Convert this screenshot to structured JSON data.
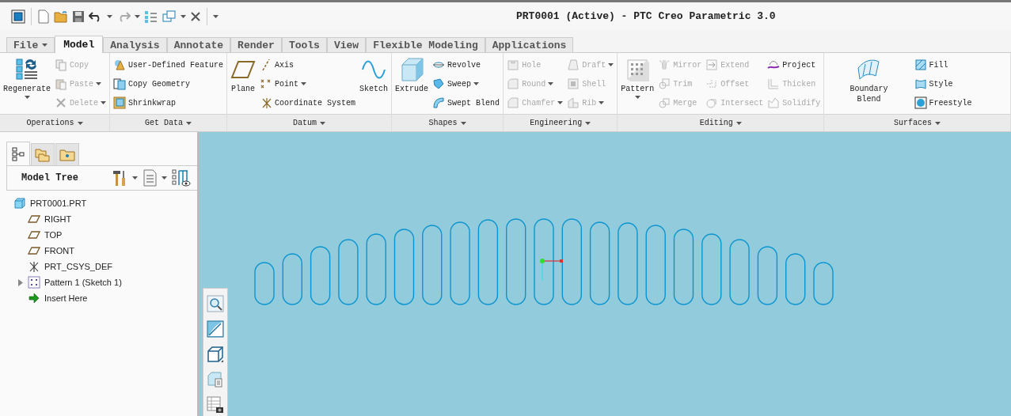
{
  "window": {
    "title": "PRT0001 (Active) - PTC Creo Parametric 3.0"
  },
  "tabs": [
    {
      "label": "File",
      "kind": "menu",
      "selected": false
    },
    {
      "label": "Model",
      "kind": "tab",
      "selected": true
    },
    {
      "label": "Analysis",
      "kind": "tab",
      "selected": false
    },
    {
      "label": "Annotate",
      "kind": "tab",
      "selected": false
    },
    {
      "label": "Render",
      "kind": "tab",
      "selected": false
    },
    {
      "label": "Tools",
      "kind": "tab",
      "selected": false
    },
    {
      "label": "View",
      "kind": "tab",
      "selected": false
    },
    {
      "label": "Flexible Modeling",
      "kind": "tab",
      "selected": false
    },
    {
      "label": "Applications",
      "kind": "tab",
      "selected": false
    }
  ],
  "ribbon": {
    "groups": [
      {
        "label": "Operations",
        "items": [
          {
            "label": "Regenerate",
            "kind": "large",
            "dropdown": true,
            "disabled": false
          },
          {
            "label": "Copy",
            "kind": "small",
            "dropdown": false,
            "disabled": true
          },
          {
            "label": "Paste",
            "kind": "small",
            "dropdown": true,
            "disabled": true
          },
          {
            "label": "Delete",
            "kind": "small",
            "dropdown": true,
            "disabled": true
          }
        ]
      },
      {
        "label": "Get Data",
        "items": [
          {
            "label": "User-Defined Feature",
            "kind": "small",
            "dropdown": false,
            "disabled": false
          },
          {
            "label": "Copy Geometry",
            "kind": "small",
            "dropdown": false,
            "disabled": false
          },
          {
            "label": "Shrinkwrap",
            "kind": "small",
            "dropdown": false,
            "disabled": false
          }
        ]
      },
      {
        "label": "Datum",
        "items": [
          {
            "label": "Plane",
            "kind": "large",
            "dropdown": false,
            "disabled": false
          },
          {
            "label": "Axis",
            "kind": "small",
            "dropdown": false,
            "disabled": false
          },
          {
            "label": "Point",
            "kind": "small",
            "dropdown": true,
            "disabled": false
          },
          {
            "label": "Coordinate System",
            "kind": "small",
            "dropdown": false,
            "disabled": false
          },
          {
            "label": "Sketch",
            "kind": "large",
            "dropdown": false,
            "disabled": false
          }
        ]
      },
      {
        "label": "Shapes",
        "items": [
          {
            "label": "Extrude",
            "kind": "large",
            "dropdown": false,
            "disabled": false
          },
          {
            "label": "Revolve",
            "kind": "small",
            "dropdown": false,
            "disabled": false
          },
          {
            "label": "Sweep",
            "kind": "small",
            "dropdown": true,
            "disabled": false
          },
          {
            "label": "Swept Blend",
            "kind": "small",
            "dropdown": false,
            "disabled": false
          }
        ]
      },
      {
        "label": "Engineering",
        "items": [
          {
            "label": "Hole",
            "kind": "small",
            "dropdown": false,
            "disabled": true
          },
          {
            "label": "Round",
            "kind": "small",
            "dropdown": true,
            "disabled": true
          },
          {
            "label": "Chamfer",
            "kind": "small",
            "dropdown": true,
            "disabled": true
          },
          {
            "label": "Draft",
            "kind": "small",
            "dropdown": true,
            "disabled": true
          },
          {
            "label": "Shell",
            "kind": "small",
            "dropdown": false,
            "disabled": true
          },
          {
            "label": "Rib",
            "kind": "small",
            "dropdown": true,
            "disabled": true
          }
        ]
      },
      {
        "label": "Editing",
        "items": [
          {
            "label": "Pattern",
            "kind": "large",
            "dropdown": true,
            "disabled": false
          },
          {
            "label": "Mirror",
            "kind": "small",
            "dropdown": false,
            "disabled": true
          },
          {
            "label": "Trim",
            "kind": "small",
            "dropdown": false,
            "disabled": true
          },
          {
            "label": "Merge",
            "kind": "small",
            "dropdown": false,
            "disabled": true
          },
          {
            "label": "Extend",
            "kind": "small",
            "dropdown": false,
            "disabled": true
          },
          {
            "label": "Offset",
            "kind": "small",
            "dropdown": false,
            "disabled": true
          },
          {
            "label": "Intersect",
            "kind": "small",
            "dropdown": false,
            "disabled": true
          },
          {
            "label": "Project",
            "kind": "small",
            "dropdown": false,
            "disabled": false
          },
          {
            "label": "Thicken",
            "kind": "small",
            "dropdown": false,
            "disabled": true
          },
          {
            "label": "Solidify",
            "kind": "small",
            "dropdown": false,
            "disabled": true
          }
        ]
      },
      {
        "label": "Surfaces",
        "items": [
          {
            "label": "Boundary Blend",
            "kind": "large",
            "dropdown": false,
            "disabled": false
          },
          {
            "label": "Fill",
            "kind": "small",
            "dropdown": false,
            "disabled": false
          },
          {
            "label": "Style",
            "kind": "small",
            "dropdown": false,
            "disabled": false
          },
          {
            "label": "Freestyle",
            "kind": "small",
            "dropdown": false,
            "disabled": false
          }
        ]
      }
    ]
  },
  "navigator": {
    "tabs": [
      {
        "selected": true
      },
      {
        "selected": false
      },
      {
        "selected": false
      }
    ],
    "title": "Model Tree",
    "tree": [
      {
        "label": "PRT0001.PRT",
        "kind": "part",
        "children": [
          {
            "label": "RIGHT",
            "kind": "plane"
          },
          {
            "label": "TOP",
            "kind": "plane"
          },
          {
            "label": "FRONT",
            "kind": "plane"
          },
          {
            "label": "PRT_CSYS_DEF",
            "kind": "csys"
          },
          {
            "label": "Pattern 1 (Sketch 1)",
            "kind": "pattern",
            "expanded": false
          },
          {
            "label": "Insert Here",
            "kind": "insert"
          }
        ]
      }
    ]
  }
}
